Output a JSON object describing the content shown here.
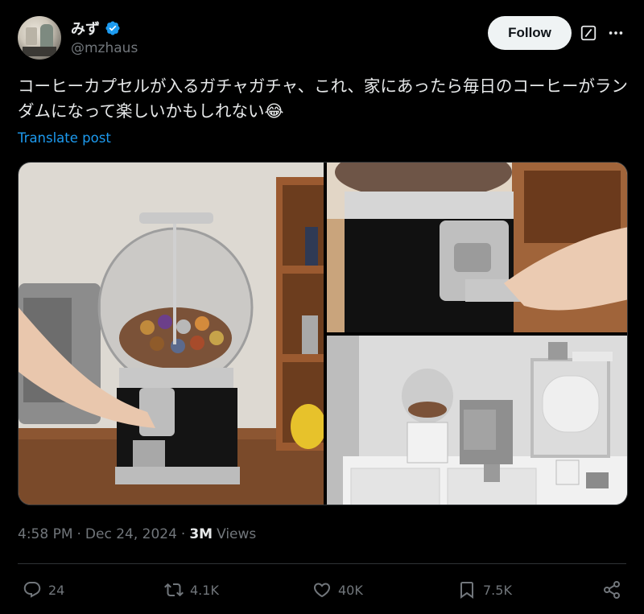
{
  "author": {
    "display_name": "みず",
    "handle": "@mzhaus",
    "verified": true
  },
  "buttons": {
    "follow_label": "Follow"
  },
  "post": {
    "text": "コーヒーカプセルが入るガチャガチャ、これ、家にあったら毎日のコーヒーがランダムになって楽しいかもしれない😂",
    "translate_label": "Translate post"
  },
  "media": {
    "image_count": 3
  },
  "meta": {
    "time": "4:58 PM",
    "separator": "·",
    "date": "Dec 24, 2024",
    "views_count": "3M",
    "views_label": "Views"
  },
  "actions": {
    "replies": "24",
    "reposts": "4.1K",
    "likes": "40K",
    "bookmarks": "7.5K"
  },
  "colors": {
    "background": "#000000",
    "text": "#e7e9ea",
    "muted": "#71767b",
    "link": "#1d9bf0",
    "verified": "#1d9bf0",
    "follow_bg": "#eff3f4"
  }
}
